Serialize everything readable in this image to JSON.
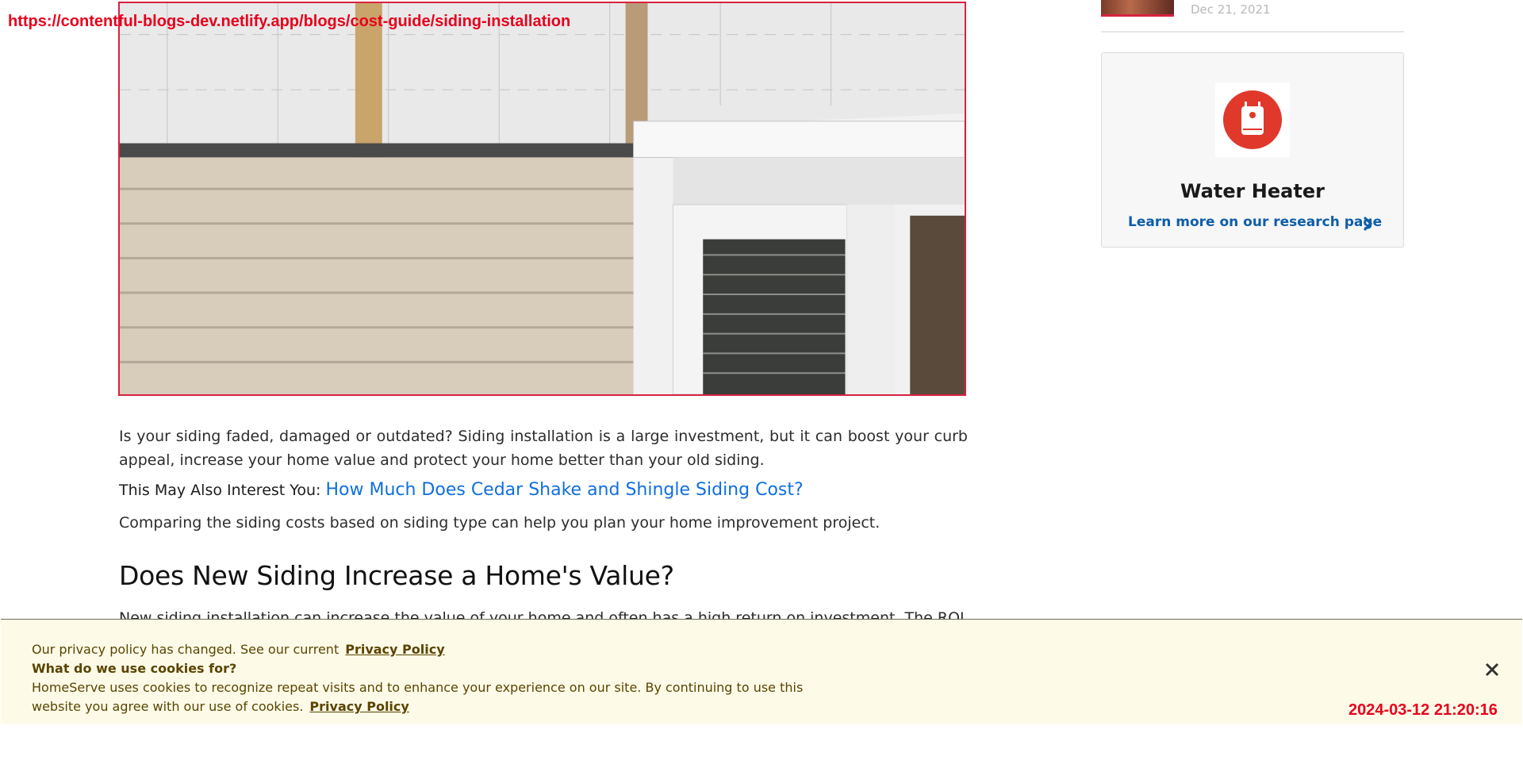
{
  "overlay": {
    "url": "https://contentful-blogs-dev.netlify.app/blogs/cost-guide/siding-installation",
    "timestamp": "2024-03-12 21:20:16"
  },
  "article": {
    "hero_alt": "New beige vinyl siding installed next to a white window frame",
    "intro": "Is your siding faded, damaged or outdated? Siding installation is a large investment, but it can boost your curb appeal, increase your home value and protect your home better than your old siding.",
    "interest_label": "This May Also Interest You:",
    "interest_link": "How Much Does Cedar Shake and Shingle Siding Cost?",
    "comparing": "Comparing the siding costs based on siding type can help you plan your home improvement project.",
    "heading": "Does New Siding Increase a Home's Value?",
    "next_para": "New siding installation can increase the value of your home and often has a high return on investment. The ROI can vary"
  },
  "sidebar": {
    "date": "Dec 21, 2021",
    "card": {
      "icon": "water-heater-icon",
      "title": "Water Heater",
      "link": "Learn more on our research page"
    }
  },
  "cookie_banner": {
    "line1": "Our privacy policy has changed. See our current",
    "privacy_link": "Privacy Policy",
    "question": "What do we use cookies for?",
    "body": "HomeServe uses cookies to recognize repeat visits and to enhance your experience on our site. By continuing to use this website you agree with our use of cookies.",
    "privacy_link_2": "Privacy Policy"
  },
  "colors": {
    "accent_red": "#d8223f",
    "link_blue": "#0f6fde",
    "cookie_bg": "#fdfbe8",
    "cookie_text": "#5a4400"
  }
}
